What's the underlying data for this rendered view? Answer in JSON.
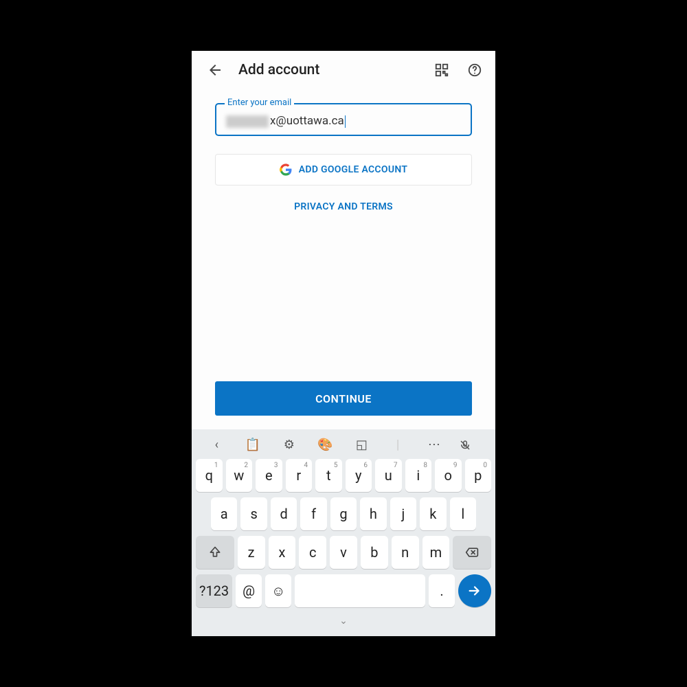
{
  "header": {
    "title": "Add account"
  },
  "email_field": {
    "label": "Enter your email",
    "value_visible": "x@uottawa.ca"
  },
  "google_button": "ADD GOOGLE ACCOUNT",
  "privacy_link": "PRIVACY AND TERMS",
  "continue_button": "CONTINUE",
  "keyboard": {
    "row1": [
      {
        "k": "q",
        "n": "1"
      },
      {
        "k": "w",
        "n": "2"
      },
      {
        "k": "e",
        "n": "3"
      },
      {
        "k": "r",
        "n": "4"
      },
      {
        "k": "t",
        "n": "5"
      },
      {
        "k": "y",
        "n": "6"
      },
      {
        "k": "u",
        "n": "7"
      },
      {
        "k": "i",
        "n": "8"
      },
      {
        "k": "o",
        "n": "9"
      },
      {
        "k": "p",
        "n": "0"
      }
    ],
    "row2": [
      "a",
      "s",
      "d",
      "f",
      "g",
      "h",
      "j",
      "k",
      "l"
    ],
    "row3": [
      "z",
      "x",
      "c",
      "v",
      "b",
      "n",
      "m"
    ],
    "numkey": "?123",
    "at": "@",
    "period": "."
  }
}
